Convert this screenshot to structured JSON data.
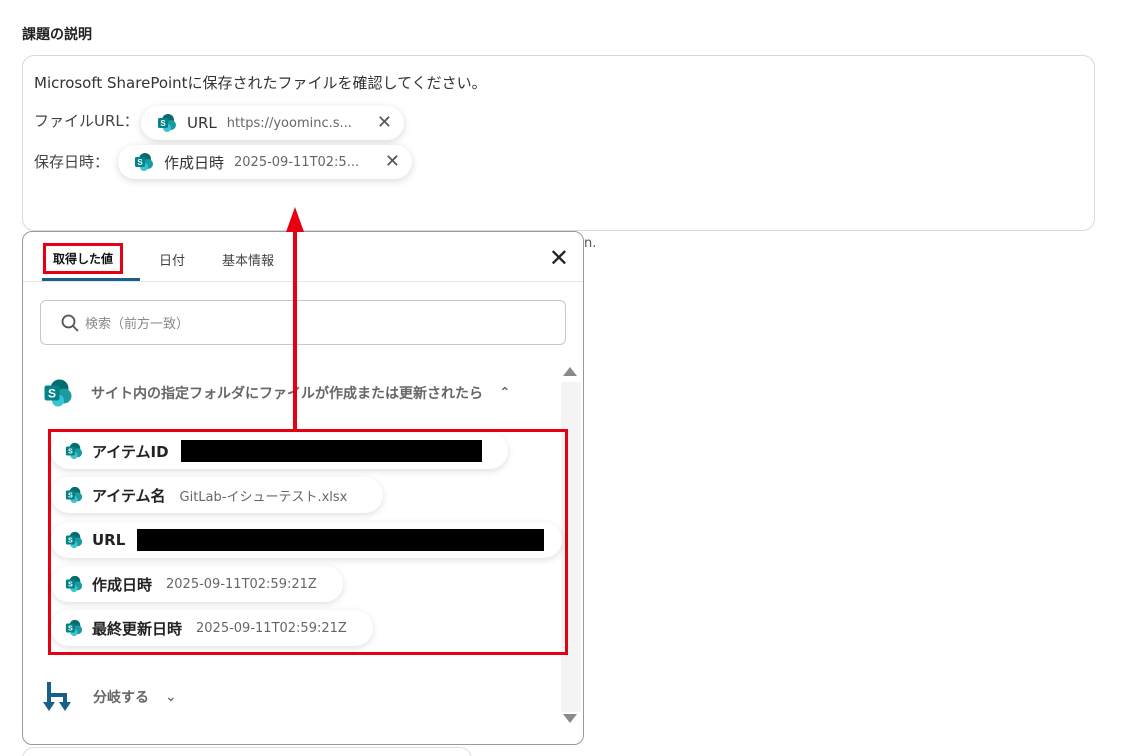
{
  "section": {
    "title": "課題の説明"
  },
  "description": {
    "line1": "Microsoft SharePointに保存されたファイルを確認してください。",
    "row1_label": "ファイルURL：",
    "row2_label": "保存日時：",
    "chip1": {
      "name": "URL",
      "value": "https://yoominc.s...",
      "close": "✕"
    },
    "chip2": {
      "name": "作成日時",
      "value": "2025-09-11T02:5...",
      "close": "✕"
    },
    "truncated_suffix": "n."
  },
  "panel": {
    "tabs": [
      {
        "label": "取得した値"
      },
      {
        "label": "日付"
      },
      {
        "label": "基本情報"
      }
    ],
    "close": "✕",
    "search": {
      "placeholder": "検索（前方一致）"
    },
    "group": {
      "title": "サイト内の指定フォルダにファイルが作成または更新されたら",
      "chevron": "⌃"
    },
    "items": [
      {
        "name": "アイテムID",
        "value": "",
        "redacted": true
      },
      {
        "name": "アイテム名",
        "value": "GitLab-イシューテスト.xlsx",
        "redacted": false
      },
      {
        "name": "URL",
        "value": "",
        "redacted": true
      },
      {
        "name": "作成日時",
        "value": "2025-09-11T02:59:21Z",
        "redacted": false
      },
      {
        "name": "最終更新日時",
        "value": "2025-09-11T02:59:21Z",
        "redacted": false
      }
    ],
    "branch": {
      "label": "分岐する",
      "chevron": "⌄"
    }
  },
  "colors": {
    "highlight": "#e60012",
    "tab_underline": "#1a5f8a",
    "sharepoint_teal": "#0b7a75"
  },
  "icons": [
    "sharepoint-icon",
    "search-icon",
    "close-icon",
    "chevron-up-icon",
    "chevron-down-icon",
    "branch-icon"
  ]
}
